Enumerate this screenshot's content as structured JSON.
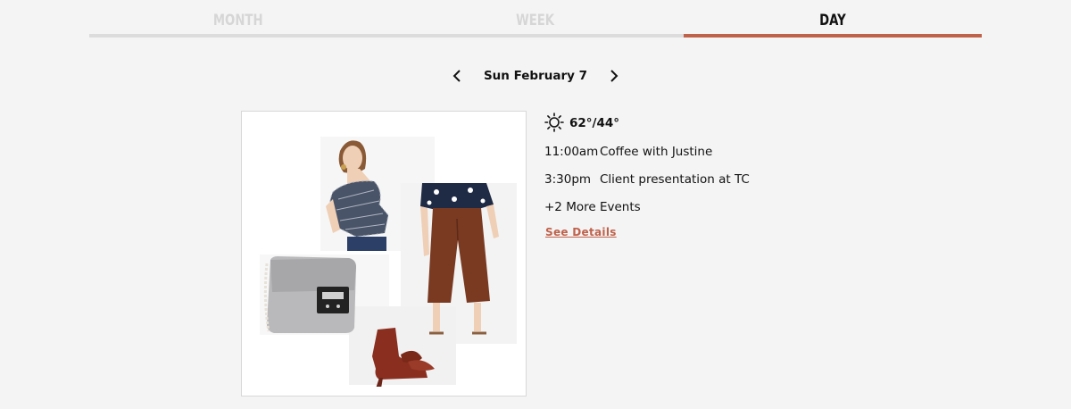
{
  "tabs": [
    {
      "label": "MONTH",
      "active": false
    },
    {
      "label": "WEEK",
      "active": false
    },
    {
      "label": "DAY",
      "active": true
    }
  ],
  "accent_color": "#c0614a",
  "date_nav": {
    "date": "Sun February 7",
    "prev_icon": "chevron-left-icon",
    "next_icon": "chevron-right-icon"
  },
  "outfit": {
    "items": [
      "one-shoulder gingham ruffle top",
      "brown wide-leg cropped trousers",
      "grey crossbody bag",
      "rust bow ankle boots"
    ]
  },
  "weather": {
    "icon": "sun-icon",
    "temp": "62°/44°"
  },
  "events": [
    {
      "time": "11:00am",
      "title": "Coffee with Justine"
    },
    {
      "time": "3:30pm",
      "title": "Client presentation at TC"
    }
  ],
  "more_events": "+2 More Events",
  "see_details": "See Details"
}
